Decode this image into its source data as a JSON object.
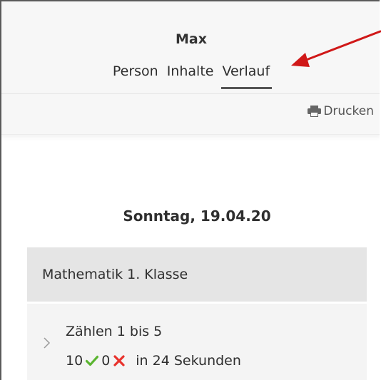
{
  "header": {
    "title": "Max",
    "tabs": [
      {
        "label": "Person"
      },
      {
        "label": "Inhalte"
      },
      {
        "label": "Verlauf"
      }
    ],
    "active_tab": "Verlauf"
  },
  "toolbar": {
    "print_label": "Drucken",
    "print_icon": "printer-icon"
  },
  "history": {
    "date": "Sonntag, 19.04.20",
    "group": "Mathematik 1. Klasse",
    "entries": [
      {
        "title": "Zählen 1 bis 5",
        "correct": "10",
        "wrong": "0",
        "duration": "in 24 Sekunden"
      }
    ]
  },
  "colors": {
    "accent_underline": "#555555",
    "check": "#5bb531",
    "cross": "#e8322c",
    "annotation_arrow": "#d01818"
  }
}
